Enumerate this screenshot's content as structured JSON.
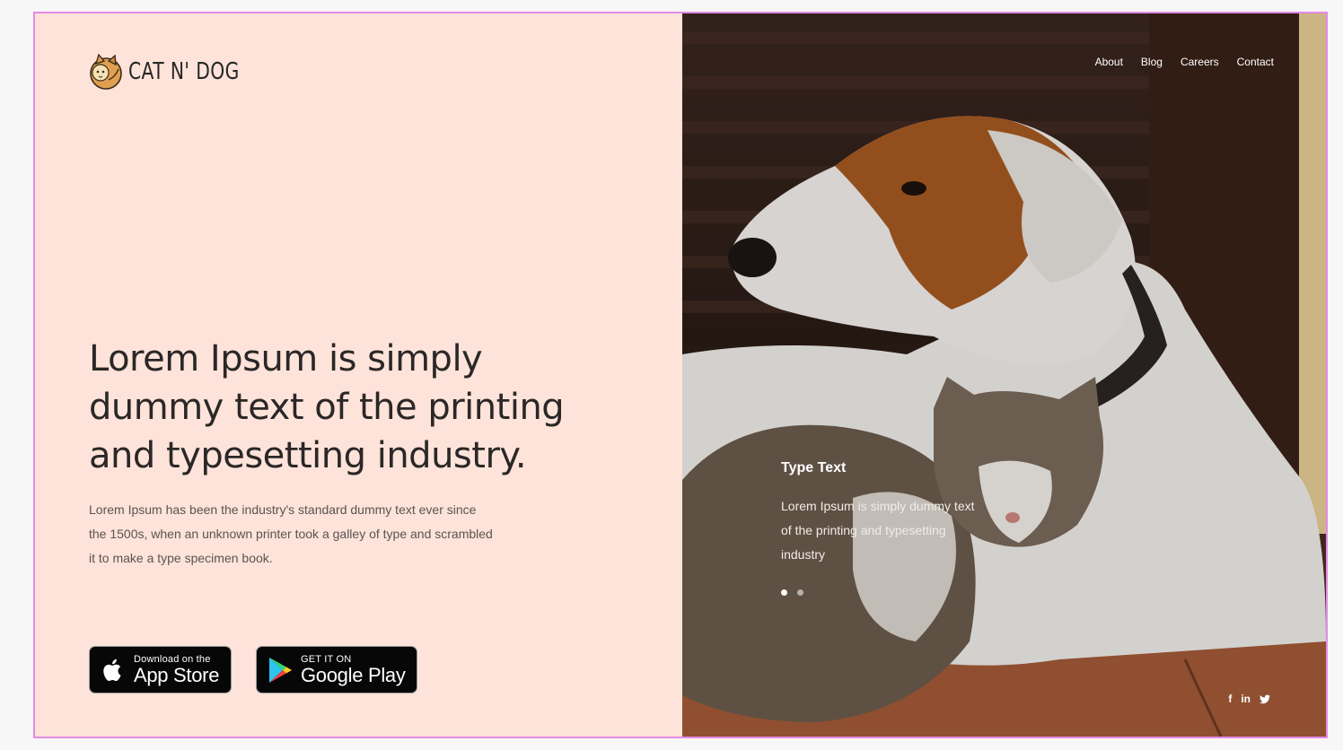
{
  "brand": {
    "name": "CAT N' DOG",
    "logo_icon": "cat-dog-logo-icon"
  },
  "nav": {
    "items": [
      "About",
      "Blog",
      "Careers",
      "Contact"
    ]
  },
  "hero": {
    "headline": "Lorem Ipsum is simply dummy text of the printing and typesetting industry.",
    "body": "Lorem Ipsum has been the industry's standard dummy text ever since the 1500s, when an unknown printer took a galley of type and scrambled it to make a type specimen book."
  },
  "stores": {
    "apple": {
      "small": "Download on the",
      "big": "App Store",
      "icon": "apple-icon"
    },
    "google": {
      "small": "GET IT ON",
      "big": "Google Play",
      "icon": "google-play-icon"
    }
  },
  "slide": {
    "title": "Type Text",
    "text": "Lorem Ipsum is simply dummy text of the printing and typesetting industry",
    "dots": 2,
    "active_dot": 1
  },
  "social": {
    "facebook": "f",
    "linkedin": "in",
    "twitter": "t"
  },
  "colors": {
    "left_background": "#fde3d9",
    "frame_border": "#e38be6",
    "headline": "#2b2727",
    "button_background": "#070707"
  }
}
